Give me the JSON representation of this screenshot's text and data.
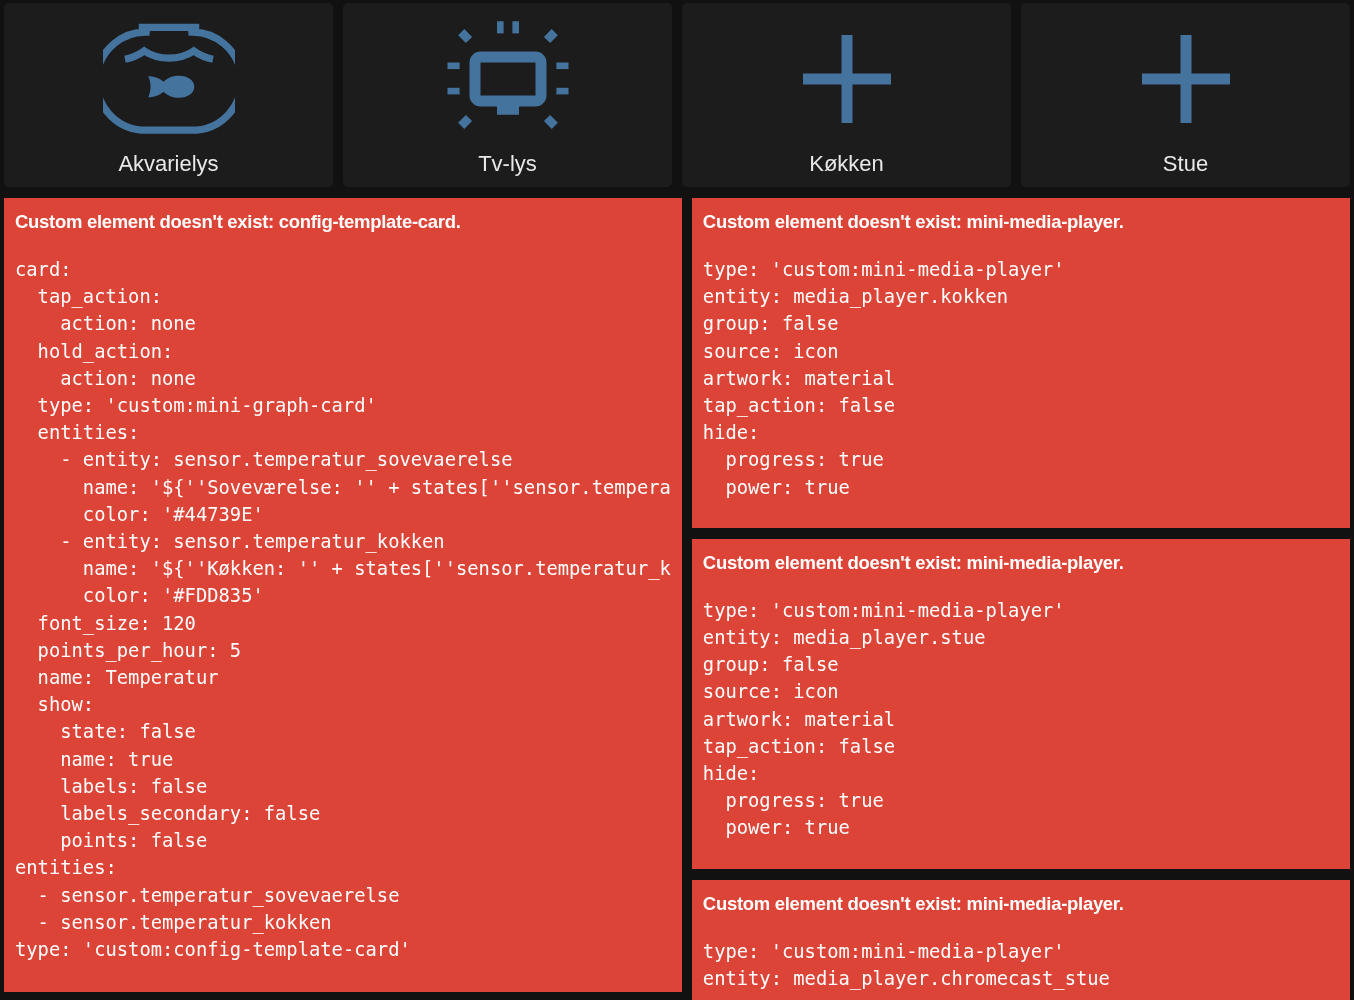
{
  "buttons": [
    {
      "label": "Akvarielys",
      "kind": "fishbowl"
    },
    {
      "label": "Tv-lys",
      "kind": "tv"
    },
    {
      "label": "Køkken",
      "kind": "plus"
    },
    {
      "label": "Stue",
      "kind": "plus"
    }
  ],
  "left_column": [
    {
      "title": "Custom element doesn't exist: config-template-card.",
      "code": [
        "card:",
        "  tap_action:",
        "    action: none",
        "  hold_action:",
        "    action: none",
        "  type: 'custom:mini-graph-card'",
        "  entities:",
        "    - entity: sensor.temperatur_sovevaerelse",
        "      name: '${''Soveværelse: '' + states[''sensor.tempera",
        "      color: '#44739E'",
        "    - entity: sensor.temperatur_kokken",
        "      name: '${''Køkken: '' + states[''sensor.temperatur_k",
        "      color: '#FDD835'",
        "  font_size: 120",
        "  points_per_hour: 5",
        "  name: Temperatur",
        "  show:",
        "    state: false",
        "    name: true",
        "    labels: false",
        "    labels_secondary: false",
        "    points: false",
        "entities:",
        "  - sensor.temperatur_sovevaerelse",
        "  - sensor.temperatur_kokken",
        "type: 'custom:config-template-card'"
      ]
    }
  ],
  "right_column": [
    {
      "title": "Custom element doesn't exist: mini-media-player.",
      "code": [
        "type: 'custom:mini-media-player'",
        "entity: media_player.kokken",
        "group: false",
        "source: icon",
        "artwork: material",
        "tap_action: false",
        "hide:",
        "  progress: true",
        "  power: true"
      ]
    },
    {
      "title": "Custom element doesn't exist: mini-media-player.",
      "code": [
        "type: 'custom:mini-media-player'",
        "entity: media_player.stue",
        "group: false",
        "source: icon",
        "artwork: material",
        "tap_action: false",
        "hide:",
        "  progress: true",
        "  power: true"
      ]
    },
    {
      "title": "Custom element doesn't exist: mini-media-player.",
      "code": [
        "type: 'custom:mini-media-player'",
        "entity: media_player.chromecast_stue"
      ]
    }
  ]
}
